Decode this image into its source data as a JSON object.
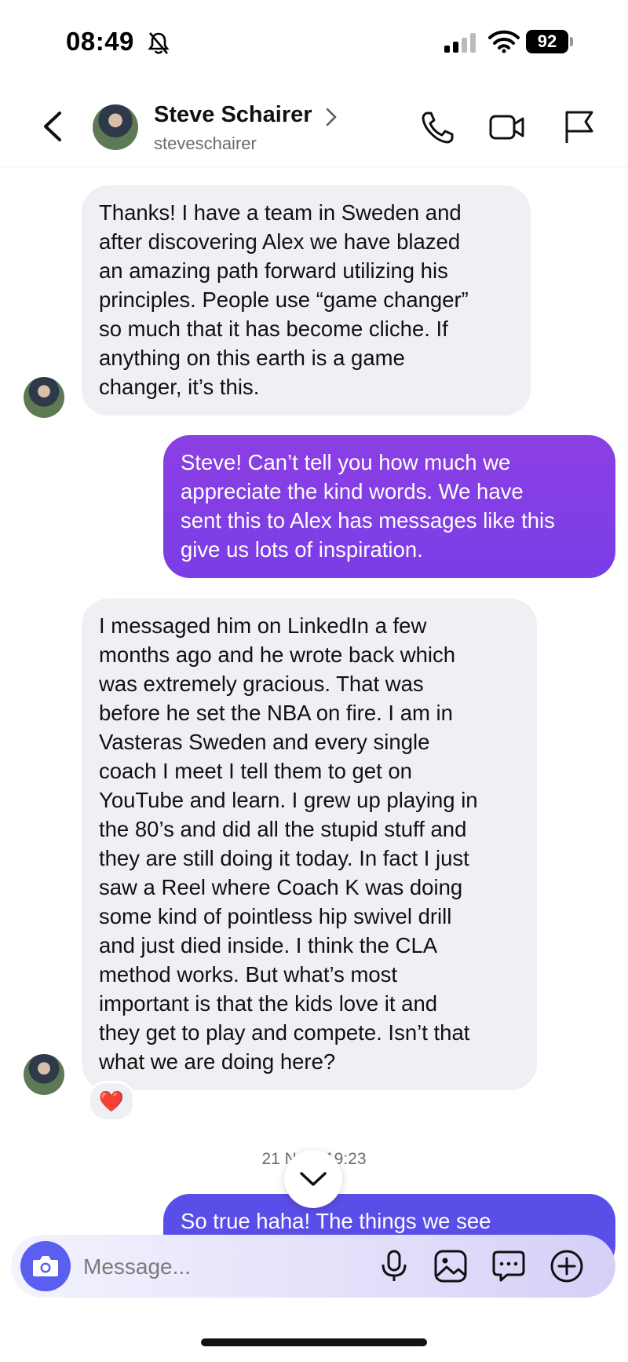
{
  "status_bar": {
    "time": "08:49",
    "battery": "92"
  },
  "header": {
    "name": "Steve Schairer",
    "username": "steveschairer"
  },
  "messages": [
    {
      "direction": "incoming",
      "text": "Thanks! I have a team in Sweden and\nafter discovering Alex we have blazed\nan amazing path forward utilizing his\nprinciples. People use “game changer”\nso much that it has become cliche. If\nanything on this earth is a game\nchanger, it’s this."
    },
    {
      "direction": "outgoing",
      "text": "Steve! Can’t tell you how much we\nappreciate the kind words. We have\nsent this to Alex has messages like this\ngive us lots of inspiration."
    },
    {
      "direction": "incoming",
      "text": "I messaged him on LinkedIn a few\nmonths ago and he wrote back which\nwas extremely gracious. That was\nbefore he set the NBA on fire. I am in\nVasteras Sweden and every single\ncoach I meet I tell them to get on\nYouTube and learn. I grew up playing in\nthe 80’s and did all the stupid stuff and\nthey are still doing it today. In fact I just\nsaw a Reel where Coach K was doing\nsome kind of pointless hip swivel drill\nand just died inside. I think the CLA\nmethod works. But what’s most\nimportant is that the kids love it and\nthey get to play and compete. Isn’t that\nwhat we are doing here?",
      "reaction": "❤️"
    },
    {
      "direction": "outgoing",
      "text": "So true haha! The things we see"
    }
  ],
  "timestamp": "21 NOV 19:23",
  "composer": {
    "placeholder": "Message..."
  },
  "colors": {
    "outgoing_bubble": "#8b3fe4",
    "incoming_bubble": "#eff0f3",
    "camera_button": "#5a5ff0"
  },
  "icons": {
    "back": "chevron-left-icon",
    "call": "phone-icon",
    "video": "video-camera-icon",
    "report": "flag-icon",
    "camera": "camera-icon",
    "mic": "microphone-icon",
    "gallery": "image-icon",
    "sticker": "chat-bubble-icon",
    "add": "plus-circle-icon",
    "scroll": "chevron-down-icon"
  }
}
